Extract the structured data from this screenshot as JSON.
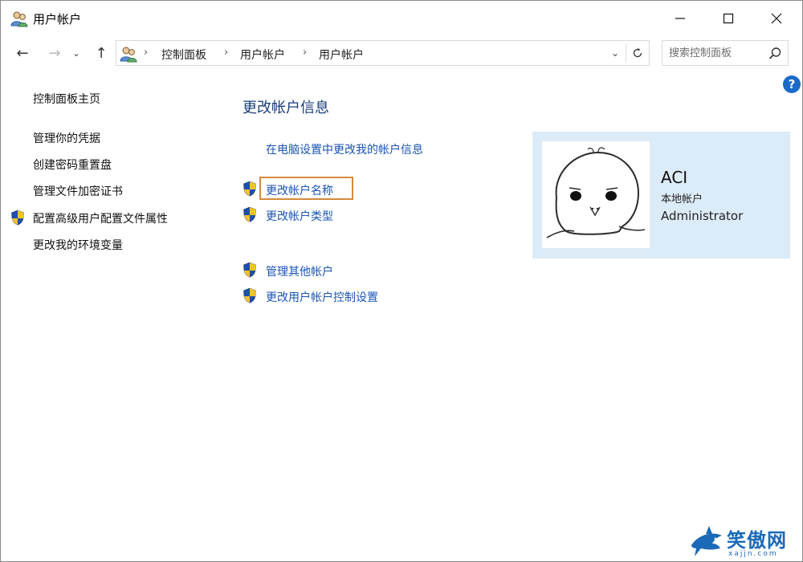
{
  "window": {
    "title": "用户帐户",
    "icon": "users-icon"
  },
  "nav": {
    "back": "←",
    "forward": "→",
    "recent": "⌄",
    "up": "↑",
    "breadcrumb": [
      "控制面板",
      "用户帐户",
      "用户帐户"
    ],
    "search_placeholder": "搜索控制面板"
  },
  "help": {
    "label": "?"
  },
  "left_nav": {
    "items": [
      {
        "label": "控制面板主页",
        "shield": false
      },
      {
        "label": "管理你的凭据",
        "shield": false
      },
      {
        "label": "创建密码重置盘",
        "shield": false
      },
      {
        "label": "管理文件加密证书",
        "shield": false
      },
      {
        "label": "配置高级用户配置文件属性",
        "shield": true
      },
      {
        "label": "更改我的环境变量",
        "shield": false
      }
    ]
  },
  "main": {
    "heading": "更改帐户信息",
    "tasks": [
      {
        "label": "在电脑设置中更改我的帐户信息",
        "shield": false
      },
      {
        "label": "更改帐户名称",
        "shield": true,
        "highlighted": true
      },
      {
        "label": "更改帐户类型",
        "shield": true
      },
      {
        "label": "管理其他帐户",
        "shield": true
      },
      {
        "label": "更改用户帐户控制设置",
        "shield": true
      }
    ]
  },
  "account": {
    "name": "ACI",
    "type": "本地帐户",
    "role": "Administrator"
  },
  "watermark": {
    "text": "笑傲网",
    "url": "xajjn.com"
  },
  "colors": {
    "link": "#1a55b5",
    "heading": "#1a3f7a",
    "panel": "#dcebf8",
    "highlight": "#d48a3c",
    "help": "#1b6ac9"
  }
}
